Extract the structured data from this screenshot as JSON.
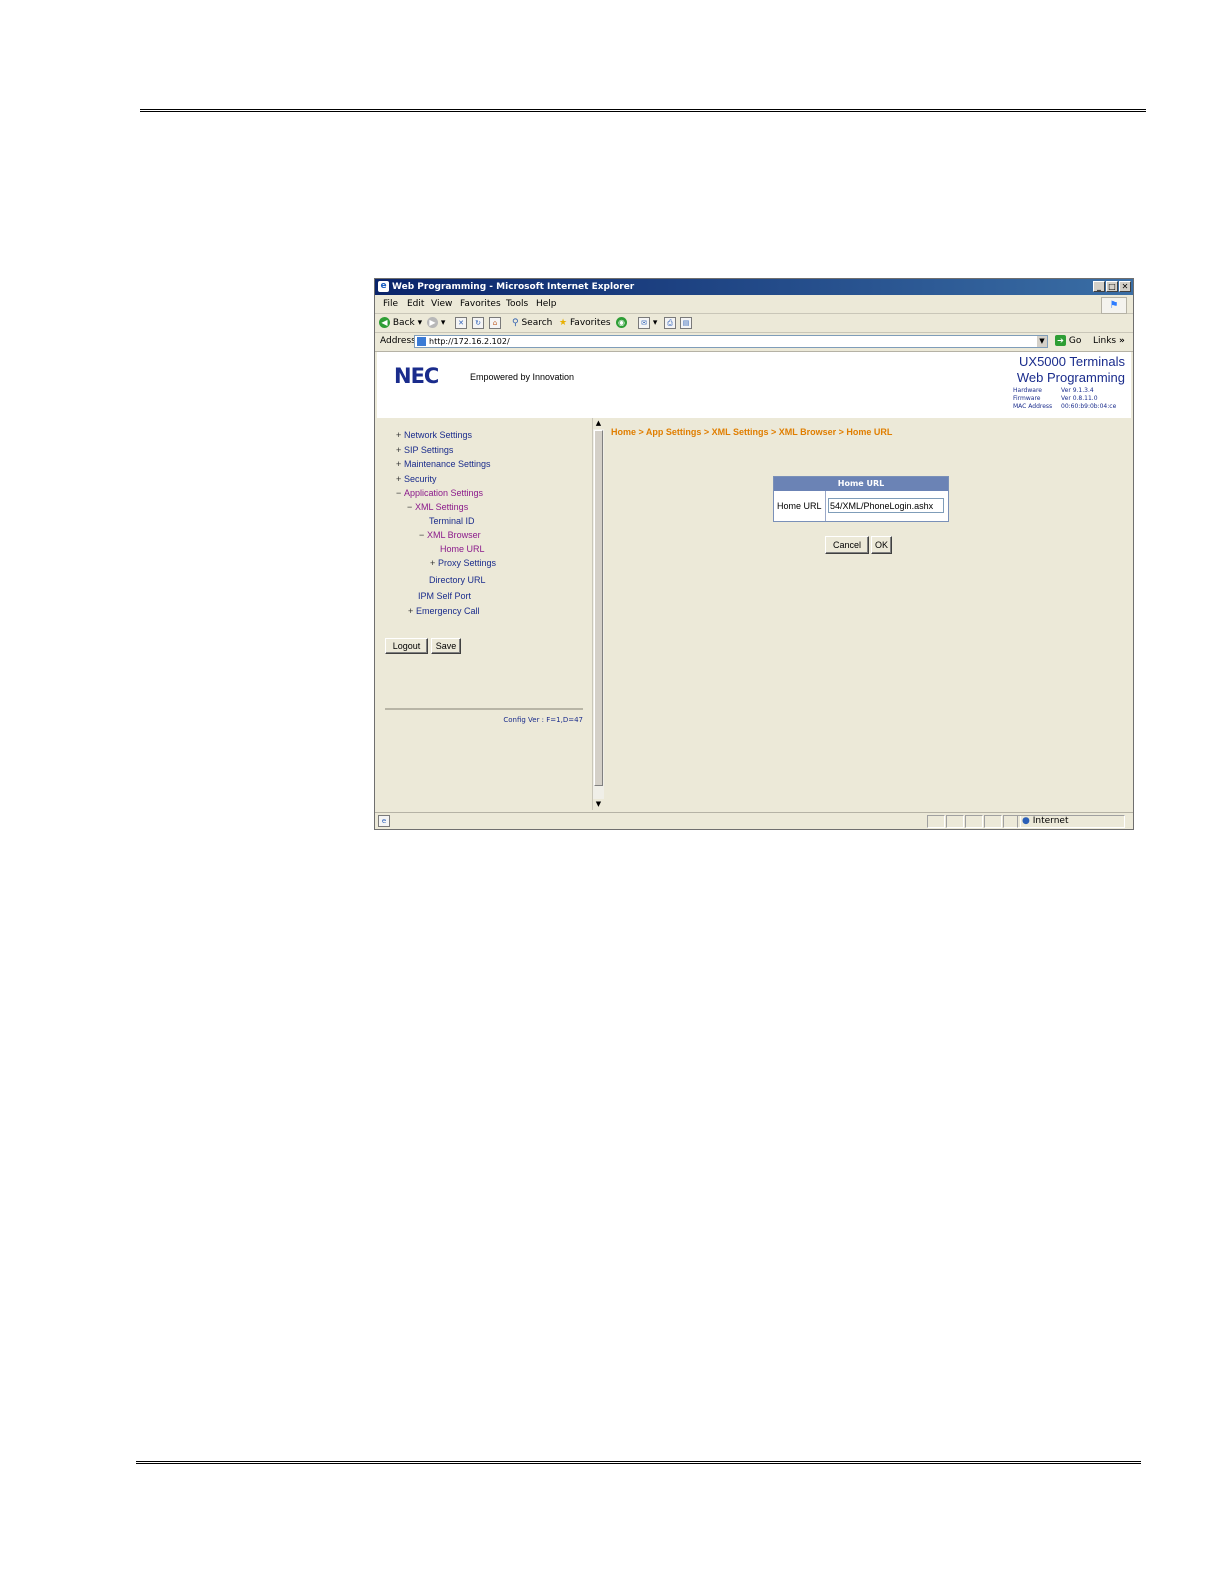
{
  "browser": {
    "title": "Web Programming - Microsoft Internet Explorer",
    "window_buttons": [
      "_",
      "□",
      "✕"
    ],
    "menu": [
      "File",
      "Edit",
      "View",
      "Favorites",
      "Tools",
      "Help"
    ],
    "toolbar": {
      "back": "Back",
      "search": "Search",
      "favorites": "Favorites"
    },
    "address_label": "Address",
    "address_value": "http://172.16.2.102/",
    "go": "Go",
    "links": "Links",
    "status_zone": "Internet"
  },
  "header": {
    "logo": "NEC",
    "tagline": "Empowered by Innovation",
    "product_line1": "UX5000 Terminals",
    "product_line2": "Web Programming",
    "hardware_label": "Hardware",
    "hardware_value": "Ver 9.1.3.4",
    "firmware_label": "Firmware",
    "firmware_value": "Ver 0.8.11.0",
    "mac_label": "MAC Address",
    "mac_value": "00:60:b9:0b:04:ce"
  },
  "tree": {
    "network": "Network Settings",
    "sip": "SIP Settings",
    "maintenance": "Maintenance Settings",
    "security": "Security",
    "application": "Application Settings",
    "xml": "XML Settings",
    "terminal_id": "Terminal ID",
    "xml_browser": "XML Browser",
    "home_url": "Home URL",
    "proxy": "Proxy Settings",
    "directory_url": "Directory URL",
    "ipm": "IPM Self Port",
    "emergency": "Emergency Call",
    "expand_glyph": "+",
    "collapse_glyph": "−"
  },
  "left_buttons": {
    "logout": "Logout",
    "save": "Save"
  },
  "config_version": "Config Ver : F=1,D=47",
  "breadcrumb": "Home > App Settings > XML Settings > XML Browser > Home URL",
  "form": {
    "header": "Home URL",
    "label": "Home URL",
    "value": "54/XML/PhoneLogin.ashx",
    "cancel": "Cancel",
    "ok": "OK"
  }
}
